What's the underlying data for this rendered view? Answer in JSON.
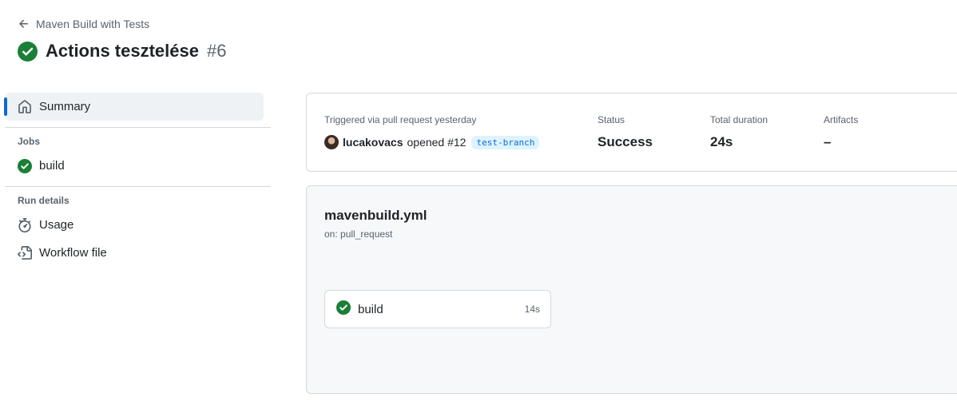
{
  "header": {
    "back_label": "Maven Build with Tests",
    "title": "Actions tesztelése",
    "run_number": "#6"
  },
  "sidebar": {
    "summary_label": "Summary",
    "jobs_heading": "Jobs",
    "jobs": [
      {
        "label": "build",
        "status": "success"
      }
    ],
    "run_details_heading": "Run details",
    "run_details": [
      {
        "label": "Usage",
        "icon": "stopwatch-icon"
      },
      {
        "label": "Workflow file",
        "icon": "file-code-icon"
      }
    ]
  },
  "summary": {
    "trigger_label": "Triggered via pull request yesterday",
    "user": "lucakovacs",
    "action": "opened #12",
    "branch": "test-branch",
    "status_label": "Status",
    "status_value": "Success",
    "duration_label": "Total duration",
    "duration_value": "24s",
    "artifacts_label": "Artifacts",
    "artifacts_value": "–"
  },
  "workflow": {
    "file_name": "mavenbuild.yml",
    "trigger": "on: pull_request",
    "jobs": [
      {
        "name": "build",
        "duration": "14s",
        "status": "success"
      }
    ]
  },
  "colors": {
    "success": "#1a7f37",
    "accent": "#0969da",
    "muted": "#59636e"
  }
}
